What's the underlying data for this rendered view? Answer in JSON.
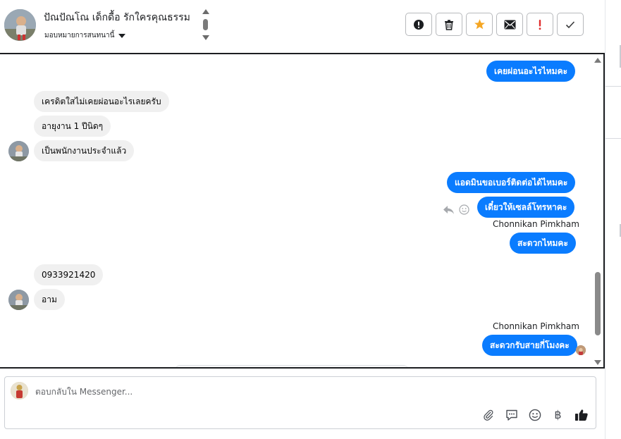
{
  "header": {
    "contact_name": "ปัณปัณโณ เด็กดื้อ รักใครคุณธรรม",
    "assign_label": "มอบหมายการสนทนานี้",
    "actions": [
      {
        "name": "alert-circle-icon"
      },
      {
        "name": "trash-icon"
      },
      {
        "name": "star-icon",
        "color": "#f5a623"
      },
      {
        "name": "envelope-icon"
      },
      {
        "name": "exclamation-icon",
        "color": "#e02d2d"
      },
      {
        "name": "checkmark-icon"
      }
    ]
  },
  "messages": {
    "out_1": "เคยผ่อนอะไรไหมคะ",
    "in_1": "เครดิตใสไม่เคยผ่อนอะไรเลยครับ",
    "in_2": "อายุงาน 1 ปีนิดๆ",
    "in_3": "เป็นพนักงานประจำแล้ว",
    "out_2": "แอดมินขอเบอร์ติดต่อได้ไหมคะ",
    "out_3": "เดี๋ยวให้เซลล์โทรหาคะ",
    "sender_1": "Chonnikan Pimkham",
    "out_4": "สะดวกไหมคะ",
    "in_4": "0933921420",
    "in_5": "อาม",
    "sender_2": "Chonnikan Pimkham",
    "out_5": "สะดวกรับสายกี่โมงคะ"
  },
  "colors": {
    "outgoing_bubble": "#0a7cff",
    "incoming_bubble": "#f0f0f0",
    "like_icon": "#1c1e21"
  },
  "composer": {
    "placeholder": "ตอบกลับใน Messenger...",
    "tools": [
      "paperclip-icon",
      "chat-bubble-icon",
      "smiley-icon",
      "baht-icon",
      "thumbs-up-icon"
    ],
    "baht_symbol": "฿"
  }
}
